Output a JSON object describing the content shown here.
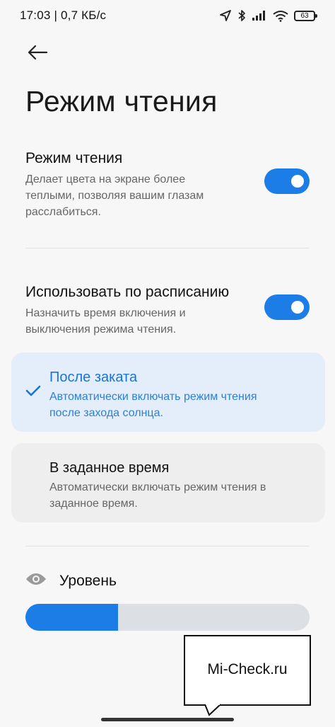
{
  "status_bar": {
    "time": "17:03 | 0,7 КБ/с",
    "battery": "63",
    "icons": [
      "location-icon",
      "bluetooth-icon",
      "signal-icon",
      "wifi-icon",
      "battery-icon"
    ]
  },
  "header": {
    "back_icon": "arrow-left-icon",
    "title": "Режим чтения"
  },
  "reading_mode": {
    "title": "Режим чтения",
    "description": "Делает цвета на экране более теплыми, позволяя вашим глазам расслабиться.",
    "enabled": true
  },
  "schedule": {
    "title": "Использовать по расписанию",
    "description": "Назначить время включения и выключения режима чтения.",
    "enabled": true
  },
  "options": [
    {
      "title": "После заката",
      "description": "Автоматически включать режим чтения после захода солнца.",
      "selected": true
    },
    {
      "title": "В заданное время",
      "description": "Автоматически включать режим чтения в заданное время.",
      "selected": false
    }
  ],
  "level": {
    "label": "Уровень",
    "icon": "eye-icon",
    "value_fraction": 0.325
  },
  "watermark": {
    "text": "Mi-Check.ru"
  },
  "colors": {
    "accent": "#1d7de6",
    "selected_card": "#e3eefa",
    "card": "#eeeeee",
    "background": "#f7f7f7"
  }
}
